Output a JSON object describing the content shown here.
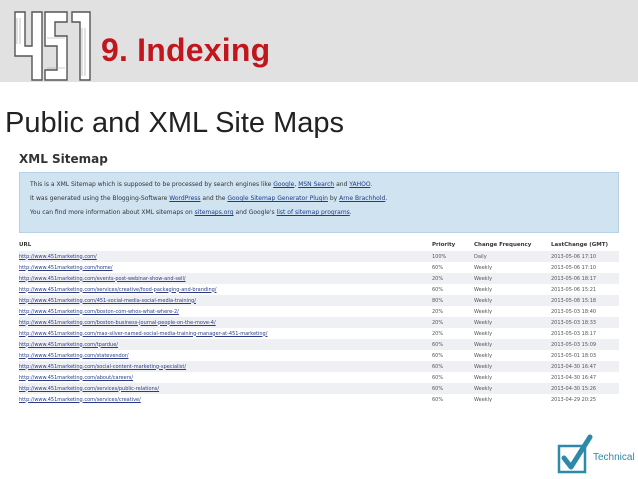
{
  "header": {
    "logo_text": "451",
    "title": "9. Indexing",
    "accent_color": "#c0171e",
    "band_color": "#e1e1e1"
  },
  "subtitle": "Public and XML Site Maps",
  "sitemap": {
    "title": "XML Sitemap",
    "info": {
      "line1_pre": "This is a XML Sitemap which is supposed to be processed by search engines like ",
      "line1_link1": "Google",
      "line1_sep1": ", ",
      "line1_link2": "MSN Search",
      "line1_sep2": " and ",
      "line1_link3": "YAHOO",
      "line1_post": ".",
      "line2_pre": "It was generated using the Blogging-Software ",
      "line2_link1": "WordPress",
      "line2_mid": " and the ",
      "line2_link2": "Google Sitemap Generator Plugin",
      "line2_by": " by ",
      "line2_link3": "Arne Brachhold",
      "line2_post": ".",
      "line3_pre": "You can find more information about XML sitemaps on ",
      "line3_link1": "sitemaps.org",
      "line3_mid": " and Google's ",
      "line3_link2": "list of sitemap programs",
      "line3_post": "."
    },
    "columns": {
      "url": "URL",
      "priority": "Priority",
      "frequency": "Change Frequency",
      "last_change": "LastChange (GMT)"
    },
    "rows": [
      {
        "url": "http://www.451marketing.com/",
        "priority": "100%",
        "frequency": "Daily",
        "last_change": "2013-05-06 17:10"
      },
      {
        "url": "http://www.451marketing.com/home/",
        "priority": "60%",
        "frequency": "Weekly",
        "last_change": "2013-05-06 17:10"
      },
      {
        "url": "http://www.451marketing.com/events-post-webinar-show-and-sell/",
        "priority": "20%",
        "frequency": "Weekly",
        "last_change": "2013-05-06 18:17"
      },
      {
        "url": "http://www.451marketing.com/services/creative/food-packaging-and-branding/",
        "priority": "60%",
        "frequency": "Weekly",
        "last_change": "2013-05-06 15:21"
      },
      {
        "url": "http://www.451marketing.com/451-social-media-social-media-training/",
        "priority": "80%",
        "frequency": "Weekly",
        "last_change": "2013-05-08 15:18"
      },
      {
        "url": "http://www.451marketing.com/boston-com-whos-what-where-2/",
        "priority": "20%",
        "frequency": "Weekly",
        "last_change": "2013-05-03 18:40"
      },
      {
        "url": "http://www.451marketing.com/boston-business-journal-people-on-the-move-4/",
        "priority": "20%",
        "frequency": "Weekly",
        "last_change": "2013-05-03 18:33"
      },
      {
        "url": "http://www.451marketing.com/max-silver-named-social-media-training-manager-at-451-marketing/",
        "priority": "20%",
        "frequency": "Weekly",
        "last_change": "2013-05-03 18:17"
      },
      {
        "url": "http://www.451marketing.com/tpardue/",
        "priority": "60%",
        "frequency": "Weekly",
        "last_change": "2013-05-03 15:09"
      },
      {
        "url": "http://www.451marketing.com/statevendor/",
        "priority": "60%",
        "frequency": "Weekly",
        "last_change": "2013-05-01 18:03"
      },
      {
        "url": "http://www.451marketing.com/social-content-marketing-specialist/",
        "priority": "60%",
        "frequency": "Weekly",
        "last_change": "2013-04-30 16:47"
      },
      {
        "url": "http://www.451marketing.com/about/careers/",
        "priority": "60%",
        "frequency": "Weekly",
        "last_change": "2013-04-30 16:47"
      },
      {
        "url": "http://www.451marketing.com/services/public-relations/",
        "priority": "60%",
        "frequency": "Weekly",
        "last_change": "2013-04-30 15:26"
      },
      {
        "url": "http://www.451marketing.com/services/creative/",
        "priority": "60%",
        "frequency": "Weekly",
        "last_change": "2013-04-29 20:25"
      }
    ]
  },
  "badge": {
    "label": "Technical",
    "icon": "checkbox-check-icon",
    "color": "#2c8aa8"
  }
}
